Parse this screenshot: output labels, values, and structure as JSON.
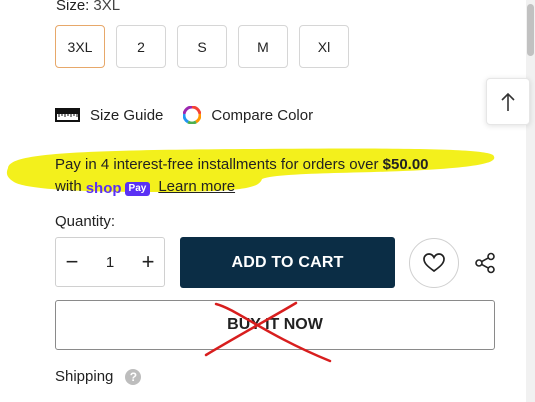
{
  "size": {
    "label": "Size:",
    "selected_value": "3XL",
    "options": [
      "3XL",
      "2",
      "S",
      "M",
      "Xl"
    ]
  },
  "links": {
    "size_guide": "Size Guide",
    "compare_color": "Compare Color"
  },
  "installments": {
    "text_before": "Pay in 4 interest-free installments for orders over",
    "amount": "$50.00",
    "with_text": "with",
    "shop_label": "shop",
    "pay_label": "Pay",
    "learn_more": "Learn more"
  },
  "quantity": {
    "label": "Quantity:",
    "value": "1",
    "minus": "−",
    "plus": "+"
  },
  "actions": {
    "add_to_cart": "ADD TO CART",
    "buy_it_now": "BUY IT NOW"
  },
  "shipping": {
    "label": "Shipping",
    "help": "?"
  },
  "icons": {
    "back_to_top": "arrow-up-icon",
    "wishlist": "heart-icon",
    "share": "share-icon",
    "size_guide": "ruler-icon",
    "compare_color": "color-wheel-icon"
  },
  "colors": {
    "add_to_cart_bg": "#0b2d45",
    "selected_size_border": "#e7a86a",
    "highlight": "#f3f01c",
    "shop_pay": "#5a31f4",
    "annotation_cross": "#d81e1e"
  }
}
